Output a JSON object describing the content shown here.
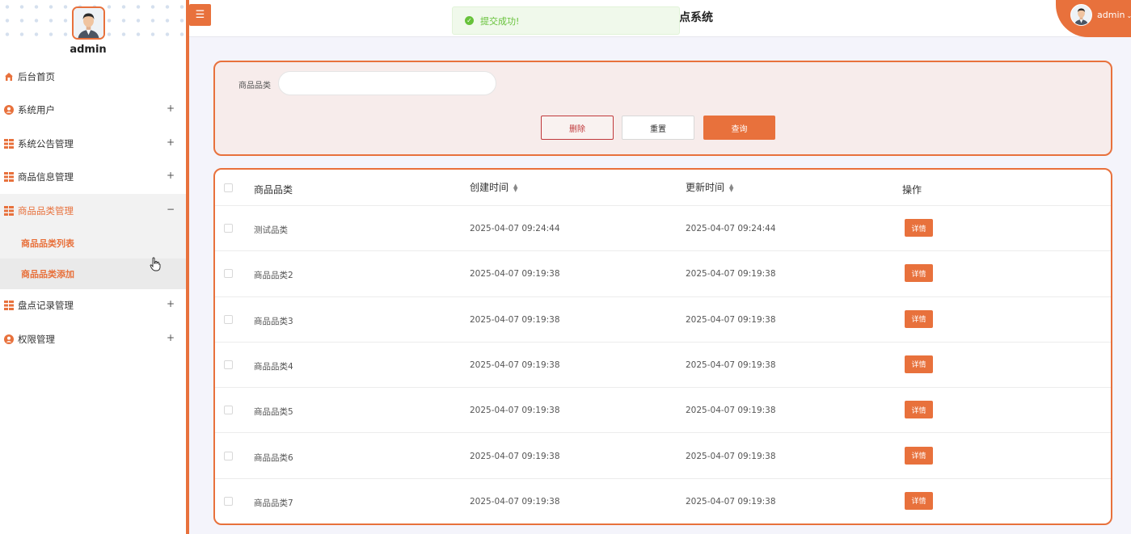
{
  "user": {
    "name": "admin",
    "dropdown": "admin"
  },
  "header": {
    "title": "点系统",
    "toast": "提交成功!"
  },
  "sidebar": {
    "items": [
      {
        "label": "后台首页",
        "icon": "home-icon",
        "expand": ""
      },
      {
        "label": "系统用户",
        "icon": "user-icon",
        "expand": "+"
      },
      {
        "label": "系统公告管理",
        "icon": "grid-icon",
        "expand": "+"
      },
      {
        "label": "商品信息管理",
        "icon": "grid-icon",
        "expand": "+"
      },
      {
        "label": "商品品类管理",
        "icon": "grid-icon",
        "expand": "−"
      },
      {
        "label": "盘点记录管理",
        "icon": "grid-icon",
        "expand": "+"
      },
      {
        "label": "权限管理",
        "icon": "user-icon",
        "expand": "+"
      }
    ],
    "subitems": [
      {
        "label": "商品品类列表"
      },
      {
        "label": "商品品类添加"
      }
    ]
  },
  "search": {
    "label": "商品品类",
    "value": "",
    "placeholder": ""
  },
  "buttons": {
    "delete": "删除",
    "reset": "重置",
    "query": "查询"
  },
  "table": {
    "headers": {
      "category": "商品品类",
      "created": "创建时间",
      "updated": "更新时间",
      "action": "操作"
    },
    "detail_label": "详情",
    "rows": [
      {
        "category": "测试品类",
        "created": "2025-04-07 09:24:44",
        "updated": "2025-04-07 09:24:44"
      },
      {
        "category": "商品品类2",
        "created": "2025-04-07 09:19:38",
        "updated": "2025-04-07 09:19:38"
      },
      {
        "category": "商品品类3",
        "created": "2025-04-07 09:19:38",
        "updated": "2025-04-07 09:19:38"
      },
      {
        "category": "商品品类4",
        "created": "2025-04-07 09:19:38",
        "updated": "2025-04-07 09:19:38"
      },
      {
        "category": "商品品类5",
        "created": "2025-04-07 09:19:38",
        "updated": "2025-04-07 09:19:38"
      },
      {
        "category": "商品品类6",
        "created": "2025-04-07 09:19:38",
        "updated": "2025-04-07 09:19:38"
      },
      {
        "category": "商品品类7",
        "created": "2025-04-07 09:19:38",
        "updated": "2025-04-07 09:19:38"
      }
    ]
  },
  "colors": {
    "accent": "#e8713c",
    "danger": "#c0393b",
    "success": "#67c23a"
  }
}
